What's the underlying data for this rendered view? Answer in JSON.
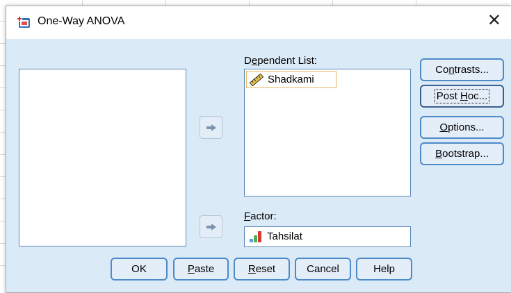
{
  "window": {
    "title": "One-Way ANOVA",
    "close_glyph": "✕",
    "icon": "spss-dialog-icon"
  },
  "source_list": {
    "items": []
  },
  "dependent_list": {
    "label_prefix": "D",
    "label_accel": "e",
    "label_suffix": "pendent List:",
    "items": [
      {
        "name": "Shadkami",
        "icon": "ruler-scale-icon"
      }
    ]
  },
  "factor": {
    "label_accel": "F",
    "label_suffix": "actor:",
    "value": "Tahsilat",
    "icon": "bar-chart-nominal-icon"
  },
  "side_buttons": {
    "contrasts": {
      "pre": "Co",
      "accel": "n",
      "post": "trasts..."
    },
    "post_hoc": {
      "pre": "Post ",
      "accel": "H",
      "post": "oc..."
    },
    "options": {
      "pre": "",
      "accel": "O",
      "post": "ptions..."
    },
    "bootstrap": {
      "pre": "",
      "accel": "B",
      "post": "ootstrap..."
    }
  },
  "bottom_buttons": {
    "ok": {
      "pre": "OK",
      "accel": "",
      "post": ""
    },
    "paste": {
      "pre": "",
      "accel": "P",
      "post": "aste"
    },
    "reset": {
      "pre": "",
      "accel": "R",
      "post": "eset"
    },
    "cancel": {
      "pre": "Cancel",
      "accel": "",
      "post": ""
    },
    "help": {
      "pre": "Help",
      "accel": "",
      "post": ""
    }
  },
  "colors": {
    "dialog_bg": "#daeaf7",
    "button_border": "#4d8ac8",
    "listbox_border": "#5b86b5",
    "selection_border": "#e7b85c"
  }
}
